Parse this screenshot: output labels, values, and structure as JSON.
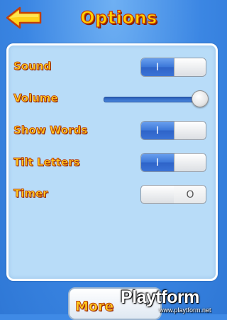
{
  "header": {
    "title": "Options",
    "back_icon": "left-arrow-icon"
  },
  "settings": {
    "sound": {
      "label": "Sound",
      "state": "on",
      "on_glyph": "I",
      "off_glyph": "O"
    },
    "volume": {
      "label": "Volume",
      "level": 1.0
    },
    "show_words": {
      "label": "Show Words",
      "state": "on",
      "on_glyph": "I",
      "off_glyph": "O"
    },
    "tilt_letters": {
      "label": "Tilt Letters",
      "state": "on",
      "on_glyph": "I",
      "off_glyph": "O"
    },
    "timer": {
      "label": "Timer",
      "state": "off",
      "on_glyph": "I",
      "off_glyph": "O"
    }
  },
  "footer": {
    "more_label": "More"
  },
  "watermark": {
    "brand": "Playtform",
    "url": "www.playtform.net"
  },
  "colors": {
    "background": "#3f8ae6",
    "panel": "#b8dcf8",
    "label_fill": "#ffcf1f",
    "label_outline": "#b93a0a",
    "toggle_on": "#3b76d8"
  }
}
